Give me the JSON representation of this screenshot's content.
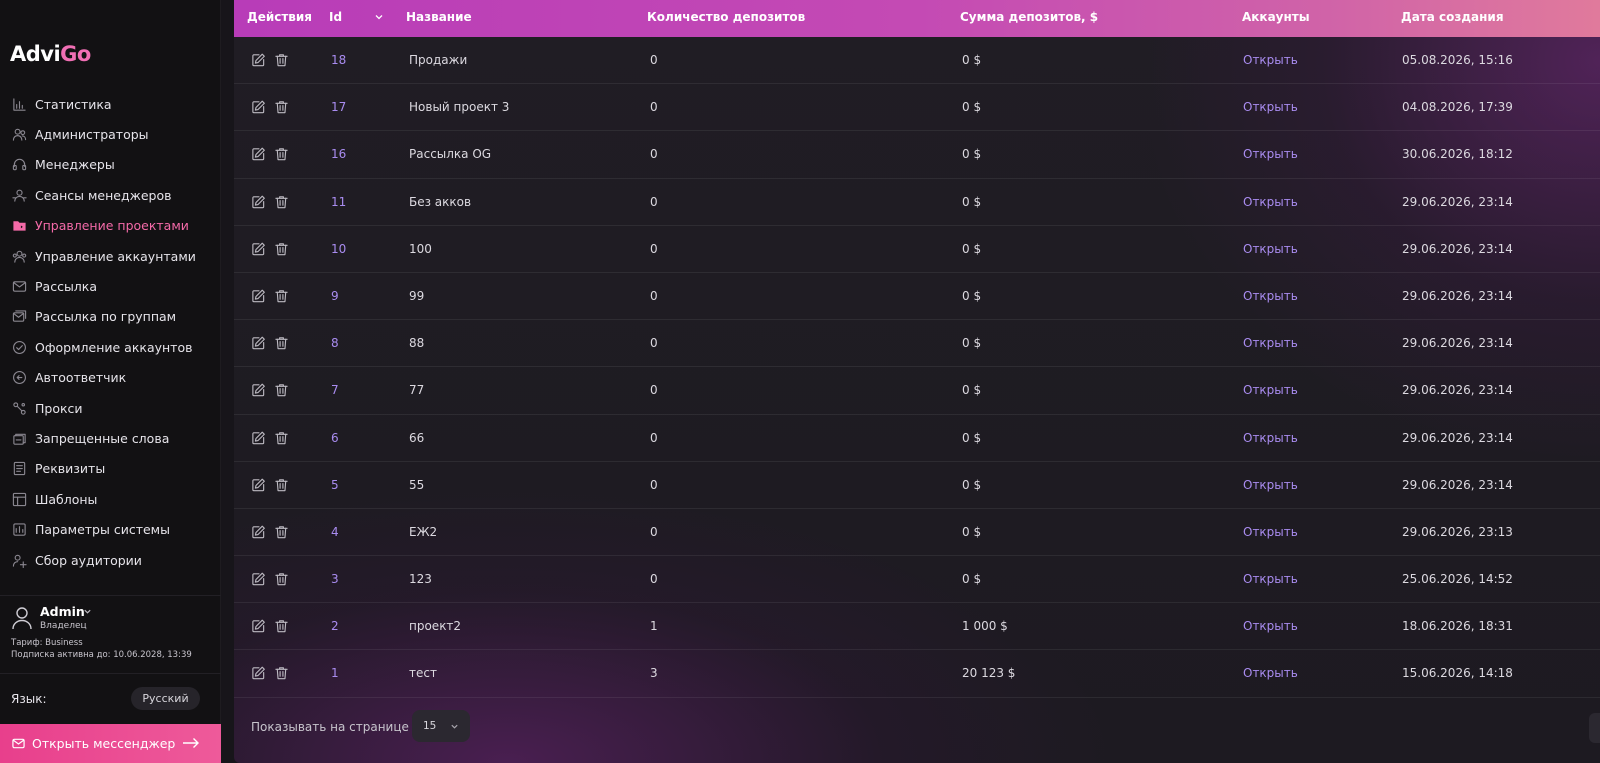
{
  "brand": {
    "name_a": "Advi",
    "name_b": "Go"
  },
  "sidebar": {
    "items": [
      {
        "label": "Статистика",
        "icon": "chart-icon"
      },
      {
        "label": "Администраторы",
        "icon": "admins-icon"
      },
      {
        "label": "Менеджеры",
        "icon": "headset-icon"
      },
      {
        "label": "Сеансы менеджеров",
        "icon": "sessions-icon"
      },
      {
        "label": "Управление проектами",
        "icon": "projects-icon",
        "active": true
      },
      {
        "label": "Управление аккаунтами",
        "icon": "accounts-icon"
      },
      {
        "label": "Рассылка",
        "icon": "mailing-icon"
      },
      {
        "label": "Рассылка по группам",
        "icon": "group-mailing-icon"
      },
      {
        "label": "Оформление аккаунтов",
        "icon": "check-circle-icon"
      },
      {
        "label": "Автоответчик",
        "icon": "autoreply-icon"
      },
      {
        "label": "Прокси",
        "icon": "proxy-icon"
      },
      {
        "label": "Запрещенные слова",
        "icon": "forbidden-words-icon"
      },
      {
        "label": "Реквизиты",
        "icon": "requisites-icon"
      },
      {
        "label": "Шаблоны",
        "icon": "templates-icon"
      },
      {
        "label": "Параметры системы",
        "icon": "settings-icon"
      },
      {
        "label": "Сбор аудитории",
        "icon": "audience-icon"
      }
    ],
    "user": {
      "name": "Admin",
      "role": "Владелец",
      "tariff": "Тариф: Business",
      "subscription": "Подписка активна до: 10.06.2028, 13:39"
    },
    "language": {
      "label": "Язык:",
      "value": "Русский"
    },
    "messenger_button": "Открыть мессенджер"
  },
  "table": {
    "headers": {
      "actions": "Действия",
      "id": "Id",
      "name": "Название",
      "deposit_count": "Количество депозитов",
      "deposit_sum": "Сумма депозитов, $",
      "accounts": "Аккаунты",
      "created": "Дата создания"
    },
    "rows": [
      {
        "id": "18",
        "name": "Продажи",
        "deposit_count": "0",
        "deposit_sum": "0 $",
        "accounts": "Открыть",
        "created": "05.08.2026, 15:16"
      },
      {
        "id": "17",
        "name": "Новый проект 3",
        "deposit_count": "0",
        "deposit_sum": "0 $",
        "accounts": "Открыть",
        "created": "04.08.2026, 17:39"
      },
      {
        "id": "16",
        "name": "Рассылка OG",
        "deposit_count": "0",
        "deposit_sum": "0 $",
        "accounts": "Открыть",
        "created": "30.06.2026, 18:12"
      },
      {
        "id": "11",
        "name": "Без акков",
        "deposit_count": "0",
        "deposit_sum": "0 $",
        "accounts": "Открыть",
        "created": "29.06.2026, 23:14"
      },
      {
        "id": "10",
        "name": "100",
        "deposit_count": "0",
        "deposit_sum": "0 $",
        "accounts": "Открыть",
        "created": "29.06.2026, 23:14"
      },
      {
        "id": "9",
        "name": "99",
        "deposit_count": "0",
        "deposit_sum": "0 $",
        "accounts": "Открыть",
        "created": "29.06.2026, 23:14"
      },
      {
        "id": "8",
        "name": "88",
        "deposit_count": "0",
        "deposit_sum": "0 $",
        "accounts": "Открыть",
        "created": "29.06.2026, 23:14"
      },
      {
        "id": "7",
        "name": "77",
        "deposit_count": "0",
        "deposit_sum": "0 $",
        "accounts": "Открыть",
        "created": "29.06.2026, 23:14"
      },
      {
        "id": "6",
        "name": "66",
        "deposit_count": "0",
        "deposit_sum": "0 $",
        "accounts": "Открыть",
        "created": "29.06.2026, 23:14"
      },
      {
        "id": "5",
        "name": "55",
        "deposit_count": "0",
        "deposit_sum": "0 $",
        "accounts": "Открыть",
        "created": "29.06.2026, 23:14"
      },
      {
        "id": "4",
        "name": "ЕЖ2",
        "deposit_count": "0",
        "deposit_sum": "0 $",
        "accounts": "Открыть",
        "created": "29.06.2026, 23:13"
      },
      {
        "id": "3",
        "name": "123",
        "deposit_count": "0",
        "deposit_sum": "0 $",
        "accounts": "Открыть",
        "created": "25.06.2026, 14:52"
      },
      {
        "id": "2",
        "name": "проект2",
        "deposit_count": "1",
        "deposit_sum": "1 000 $",
        "accounts": "Открыть",
        "created": "18.06.2026, 18:31"
      },
      {
        "id": "1",
        "name": "тест",
        "deposit_count": "3",
        "deposit_sum": "20 123 $",
        "accounts": "Открыть",
        "created": "15.06.2026, 14:18"
      }
    ]
  },
  "pagination": {
    "label": "Показывать на странице",
    "page_size": "15"
  },
  "colors": {
    "accent_pink": "#f46aa8",
    "link_purple": "#a98cf0",
    "header_gradient_start": "#b83cb8",
    "header_gradient_end": "#e07a9c"
  }
}
